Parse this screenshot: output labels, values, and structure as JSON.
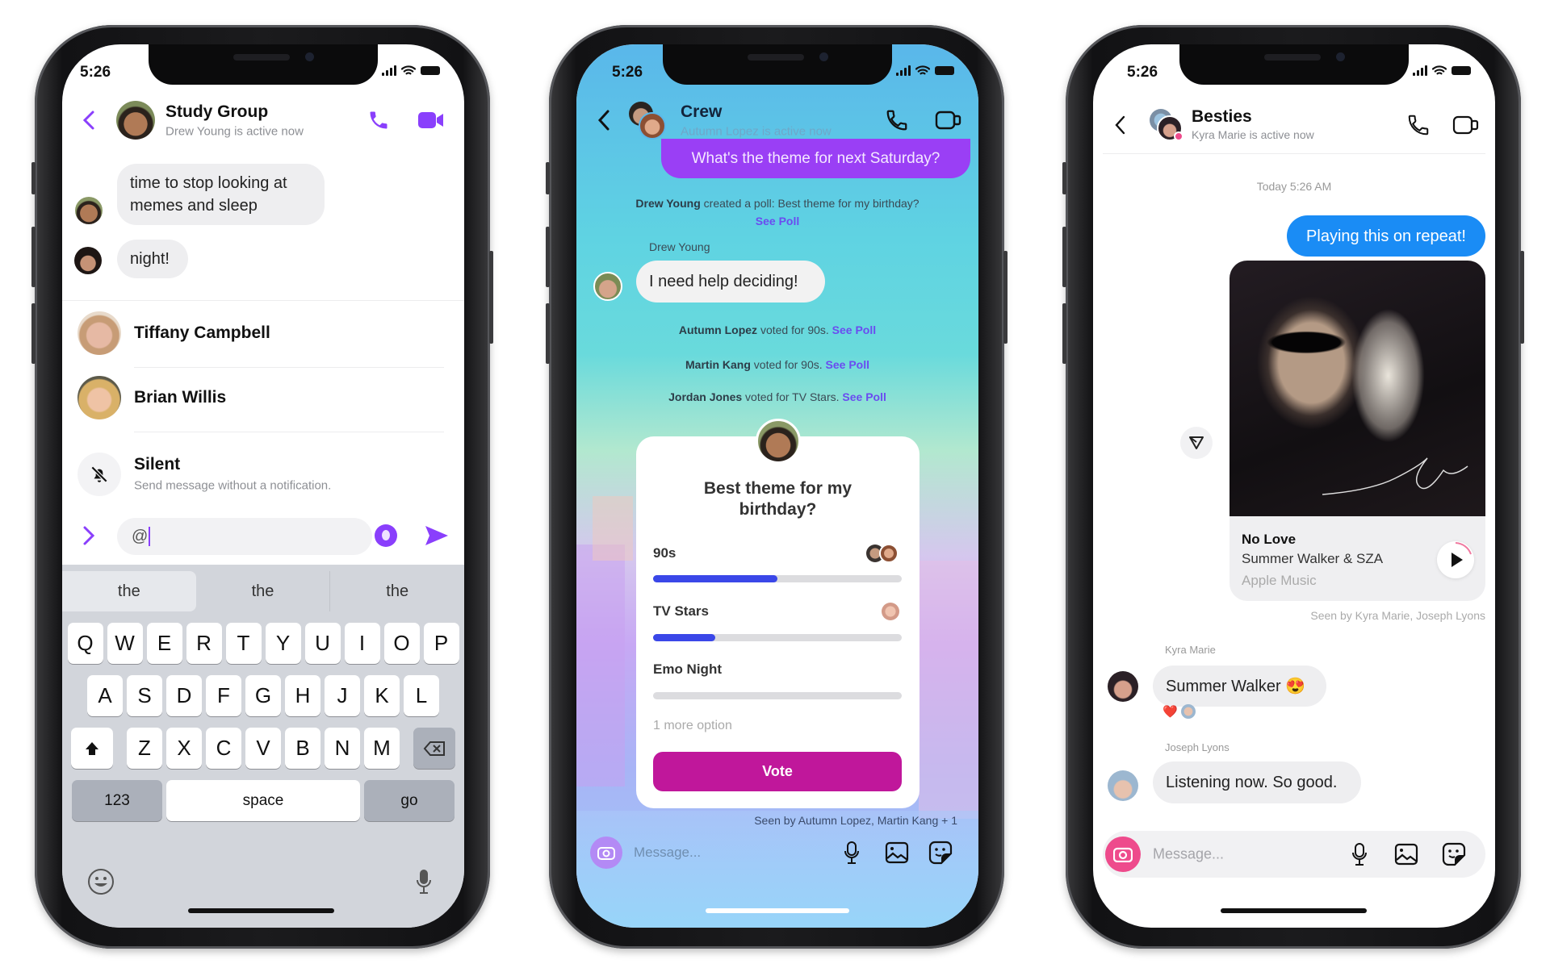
{
  "phones": [
    {
      "status_time": "5:26",
      "accent": "#8a3ffc",
      "header": {
        "title": "Study Group",
        "subtitle": "Drew Young is active now"
      },
      "messages": [
        {
          "text_line1": "time to stop looking at",
          "text_line2": "memes and sleep"
        },
        {
          "text": "night!"
        }
      ],
      "mentions": [
        {
          "name": "Tiffany Campbell"
        },
        {
          "name": "Brian Willis"
        }
      ],
      "silent": {
        "title": "Silent",
        "subtitle": "Send message without a notification."
      },
      "composer": {
        "value": "@"
      },
      "keyboard": {
        "suggestions": [
          "the",
          "the",
          "the"
        ],
        "row1": [
          "Q",
          "W",
          "E",
          "R",
          "T",
          "Y",
          "U",
          "I",
          "O",
          "P"
        ],
        "row2": [
          "A",
          "S",
          "D",
          "F",
          "G",
          "H",
          "J",
          "K",
          "L"
        ],
        "row3": [
          "Z",
          "X",
          "C",
          "V",
          "B",
          "N",
          "M"
        ],
        "numbers": "123",
        "space": "space",
        "go": "go"
      }
    },
    {
      "status_time": "5:26",
      "header": {
        "title": "Crew",
        "subtitle": "Autumn Lopez is active now"
      },
      "outgoing": "What's the theme for next Saturday?",
      "poll_created": {
        "actor": "Drew Young",
        "text": "created a poll: Best theme for my birthday?",
        "link": "See Poll"
      },
      "sender_label": "Drew Young",
      "incoming": "I need help deciding!",
      "votes": [
        {
          "actor": "Autumn Lopez",
          "text": "voted for 90s.",
          "link": "See Poll"
        },
        {
          "actor": "Martin Kang",
          "text": "voted for 90s.",
          "link": "See Poll"
        },
        {
          "actor": "Jordan Jones",
          "text": "voted for TV Stars.",
          "link": "See Poll"
        }
      ],
      "poll": {
        "question_line1": "Best theme for my",
        "question_line2": "birthday?",
        "options": [
          {
            "label": "90s",
            "percent": 50
          },
          {
            "label": "TV Stars",
            "percent": 25
          },
          {
            "label": "Emo Night",
            "percent": 0
          }
        ],
        "more": "1 more option",
        "vote_label": "Vote",
        "vote_color": "#c0179b",
        "bar_color": "#3a47e8"
      },
      "seen": "Seen by Autumn Lopez, Martin Kang + 1",
      "composer_placeholder": "Message..."
    },
    {
      "status_time": "5:26",
      "header": {
        "title": "Besties",
        "subtitle": "Kyra Marie is active now"
      },
      "timestamp": "Today 5:26 AM",
      "outgoing": "Playing this on repeat!",
      "outgoing_color": "#1a8cf5",
      "music": {
        "title": "No Love",
        "artist": "Summer Walker & SZA",
        "source": "Apple Music"
      },
      "seen": "Seen by Kyra Marie, Joseph Lyons",
      "messages": [
        {
          "sender": "Kyra Marie",
          "text": "Summer Walker 😍",
          "reaction": "❤️"
        },
        {
          "sender": "Joseph Lyons",
          "text": "Listening now. So good."
        }
      ],
      "composer_placeholder": "Message...",
      "camera_color": "#ee4b8c"
    }
  ]
}
